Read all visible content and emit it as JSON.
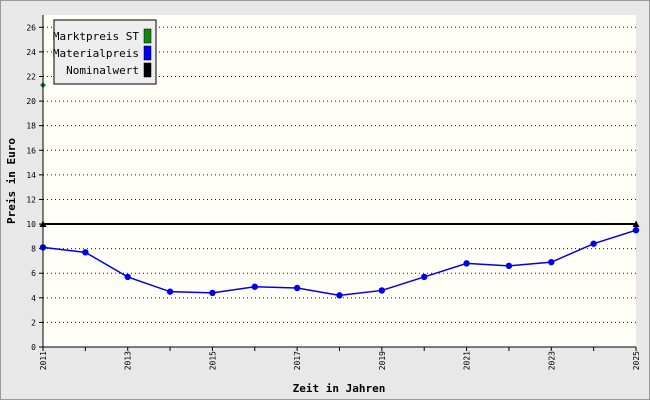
{
  "chart_data": {
    "type": "line",
    "xlabel": "Zeit in Jahren",
    "ylabel": "Preis in Euro",
    "xlim": [
      2011,
      2025
    ],
    "ylim": [
      0,
      27
    ],
    "x_ticks": [
      2011,
      2013,
      2015,
      2017,
      2019,
      2021,
      2023,
      2025
    ],
    "y_ticks": [
      0,
      2,
      4,
      6,
      8,
      10,
      12,
      14,
      16,
      18,
      20,
      22,
      24,
      26
    ],
    "grid": "horizontal dotted",
    "legend_position": "top-left",
    "series": [
      {
        "name": "Marktpreis ST",
        "color": "#118811",
        "x": [
          2011
        ],
        "y": [
          21.3
        ]
      },
      {
        "name": "Materialpreis",
        "color": "#0000ee",
        "x": [
          2011,
          2012,
          2013,
          2014,
          2015,
          2016,
          2017,
          2018,
          2019,
          2020,
          2021,
          2022,
          2023,
          2024,
          2025
        ],
        "y": [
          8.1,
          7.7,
          5.7,
          4.5,
          4.4,
          4.9,
          4.8,
          4.2,
          4.6,
          5.7,
          6.8,
          6.6,
          6.9,
          8.4,
          9.5
        ]
      },
      {
        "name": "Nominalwert",
        "color": "#000000",
        "x": [
          2011,
          2025
        ],
        "y": [
          10,
          10
        ]
      }
    ]
  }
}
